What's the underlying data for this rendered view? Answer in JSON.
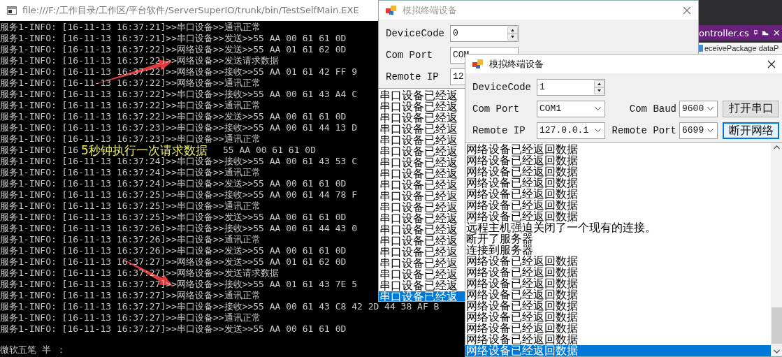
{
  "editor": {
    "tab_title": "ontroller.cs",
    "code_line": "eceivePackage dataP"
  },
  "console": {
    "title": "file:///F:/工作目录/工作区/平台软件/ServerSuperIO/trunk/bin/TestSelfMain.EXE",
    "lines": [
      "服务1-INFO: [16-11-13 16:37:21]>>串口设备>>通讯正常",
      "服务1-INFO: [16-11-13 16:37:21]>>串口设备>>发送>>55 AA 00 61 61 0D",
      "服务1-INFO: [16-11-13 16:37:22]>>网络设备>>发送>>55 AA 01 61 62 0D",
      "服务1-INFO: [16-11-13 16:37:22]>>网络设备>>发送请求数据",
      "服务1-INFO: [16-11-13 16:37:22]>>网络设备>>接收>>55 AA 01 61 42 FF 9",
      "服务1-INFO: [16-11-13 16:37:22]>>网络设备>>通讯正常",
      "服务1-INFO: [16-11-13 16:37:22]>>串口设备>>接收>>55 AA 00 61 43 A4 C",
      "服务1-INFO: [16-11-13 16:37:22]>>串口设备>>通讯正常",
      "服务1-INFO: [16-11-13 16:37:22]>>串口设备>>发送>>55 AA 00 61 61 0D",
      "服务1-INFO: [16-11-13 16:37:23]>>串口设备>>接收>>55 AA 00 61 44 13 D",
      "服务1-INFO: [16-11-13 16:37:23]>>串口设备>>通讯正常",
      [
        "服务1-INFO: [16",
        "55 AA 00 61 61 0D"
      ],
      "服务1-INFO: [16-11-13 16:37:24]>>串口设备>>接收>>55 AA 00 61 43 53 C",
      "服务1-INFO: [16-11-13 16:37:24]>>串口设备>>通讯正常",
      "服务1-INFO: [16-11-13 16:37:24]>>串口设备>>发送>>55 AA 00 61 61 0D",
      "服务1-INFO: [16-11-13 16:37:25]>>串口设备>>接收>>55 AA 00 61 44 78 F",
      "服务1-INFO: [16-11-13 16:37:25]>>串口设备>>通讯正常",
      "服务1-INFO: [16-11-13 16:37:25]>>串口设备>>发送>>55 AA 00 61 61 0D",
      "服务1-INFO: [16-11-13 16:37:26]>>串口设备>>接收>>55 AA 00 61 44 43 0",
      "服务1-INFO: [16-11-13 16:37:26]>>串口设备>>通讯正常",
      "服务1-INFO: [16-11-13 16:37:26]>>串口设备>>发送>>55 AA 00 61 61 0D",
      "服务1-INFO: [16-11-13 16:37:27]>>网络设备>>发送>>55 AA 01 61 62 0D",
      "服务1-INFO: [16-11-13 16:37:27]>>网络设备>>发送请求数据",
      "服务1-INFO: [16-11-13 16:37:27]>>网络设备>>接收>>55 AA 01 61 43 7E 5",
      "服务1-INFO: [16-11-13 16:37:27]>>网络设备>>通讯正常",
      "服务1-INFO: [16-11-13 16:37:27]>>串口设备>>接收>>55 AA 00 61 43 C8 42 2D 44 38 AF B",
      "服务1-INFO: [16-11-13 16:37:27]>>串口设备>>通讯正常",
      "服务1-INFO: [16-11-13 16:37:27]>>串口设备>>发送>>55 AA 00 61 61 0D"
    ],
    "ime_status": "微软五笔 半 ："
  },
  "annotation": {
    "text": "5秒钟执行一次请求数据"
  },
  "windows": [
    {
      "title": "模拟终端设备",
      "active": false,
      "rows": [
        [
          {
            "kind": "label",
            "text": "DeviceCode"
          },
          {
            "kind": "spinner",
            "value": "0"
          }
        ],
        [
          {
            "kind": "label",
            "text": "Com Port"
          },
          {
            "kind": "combo",
            "value": "COM"
          }
        ],
        [
          {
            "kind": "label",
            "text": "Remote IP"
          },
          {
            "kind": "combo",
            "value": "12"
          }
        ]
      ],
      "log": [
        {
          "text": "串口设备已经返",
          "selected": false
        },
        {
          "text": "串口设备已经返",
          "selected": false
        },
        {
          "text": "串口设备已经返",
          "selected": false
        },
        {
          "text": "串口设备已经返",
          "selected": false
        },
        {
          "text": "串口设备已经返",
          "selected": false
        },
        {
          "text": "串口设备已经返",
          "selected": false
        },
        {
          "text": "串口设备已经返",
          "selected": false
        },
        {
          "text": "串口设备已经返",
          "selected": false
        },
        {
          "text": "串口设备已经返",
          "selected": false
        },
        {
          "text": "串口设备已经返",
          "selected": false
        },
        {
          "text": "串口设备已经返",
          "selected": false
        },
        {
          "text": "串口设备已经返",
          "selected": false
        },
        {
          "text": "串口设备已经返",
          "selected": false
        },
        {
          "text": "串口设备已经返",
          "selected": false
        },
        {
          "text": "串口设备已经返",
          "selected": false
        },
        {
          "text": "串口设备已经返",
          "selected": false
        },
        {
          "text": "串口设备已经返",
          "selected": false
        },
        {
          "text": "串口设备已经返",
          "selected": false
        },
        {
          "text": "串口设备已经返",
          "selected": true
        }
      ]
    },
    {
      "title": "模拟终端设备",
      "active": true,
      "rows": [
        [
          {
            "kind": "label",
            "text": "DeviceCode"
          },
          {
            "kind": "spinner",
            "value": "1"
          }
        ],
        [
          {
            "kind": "label",
            "text": "Com Port"
          },
          {
            "kind": "combo",
            "value": "COM1"
          },
          {
            "kind": "label",
            "text": "Com Baud"
          },
          {
            "kind": "combo",
            "value": "9600"
          },
          {
            "kind": "button",
            "text": "打开串口",
            "focused": false
          }
        ],
        [
          {
            "kind": "label",
            "text": "Remote IP"
          },
          {
            "kind": "combo",
            "value": "127.0.0.1"
          },
          {
            "kind": "label",
            "text": "Remote Port"
          },
          {
            "kind": "combo",
            "value": "6699"
          },
          {
            "kind": "button",
            "text": "断开网络",
            "focused": true
          }
        ]
      ],
      "log": [
        {
          "text": "网络设备已经返回数据",
          "selected": false
        },
        {
          "text": "网络设备已经返回数据",
          "selected": false
        },
        {
          "text": "网络设备已经返回数据",
          "selected": false
        },
        {
          "text": "网络设备已经返回数据",
          "selected": false
        },
        {
          "text": "网络设备已经返回数据",
          "selected": false
        },
        {
          "text": "网络设备已经返回数据",
          "selected": false
        },
        {
          "text": "网络设备已经返回数据",
          "selected": false
        },
        {
          "text": "远程主机强迫关闭了一个现有的连接。",
          "selected": false
        },
        {
          "text": "断开了服务器",
          "selected": false
        },
        {
          "text": "连接到服务器",
          "selected": false
        },
        {
          "text": "网络设备已经返回数据",
          "selected": false
        },
        {
          "text": "网络设备已经返回数据",
          "selected": false
        },
        {
          "text": "网络设备已经返回数据",
          "selected": false
        },
        {
          "text": "网络设备已经返回数据",
          "selected": false
        },
        {
          "text": "网络设备已经返回数据",
          "selected": false
        },
        {
          "text": "网络设备已经返回数据",
          "selected": false
        },
        {
          "text": "网络设备已经返回数据",
          "selected": false
        },
        {
          "text": "网络设备已经返回数据",
          "selected": false
        },
        {
          "text": "网络设备已经返回数据",
          "selected": true
        }
      ]
    }
  ]
}
